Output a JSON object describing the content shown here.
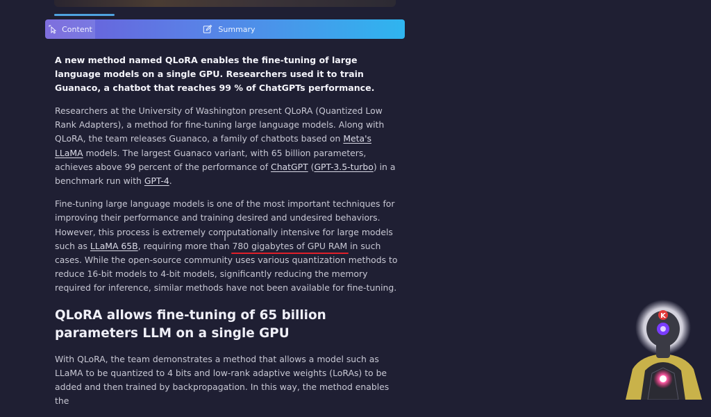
{
  "tabs": {
    "content_label": "Content",
    "summary_label": "Summary"
  },
  "article": {
    "lead": "A new method named QLoRA enables the fine-tuning of large language models on a single GPU. Researchers used it to train Guanaco, a chatbot that reaches 99 % of ChatGPTs performance.",
    "p1": {
      "t1": "Researchers at the University of Washington present QLoRA (Quantized Low Rank Adapters), a method for fine-tuning large language models. Along with QLoRA, the team releases Guanaco, a family of chatbots based on ",
      "link_llama": "Meta's LLaMA",
      "t2": " models. The largest Guanaco variant, with 65 billion parameters, achieves above 99 percent of the performance of ",
      "link_chatgpt": "ChatGPT",
      "t3": " (",
      "link_gpt35": "GPT-3.5-turbo",
      "t4": ") in a benchmark run with ",
      "link_gpt4": "GPT-4",
      "t5": "."
    },
    "p2": {
      "t1": "Fine-tuning large language models is one of the most important techniques for improving their performance and training desired and undesired behaviors. However, this process is extremely computationally intensive for large models such as ",
      "link_llama65b": "LLaMA 65B",
      "t2": ", requiring more than ",
      "highlight": "780 gigabytes of GPU RAM",
      "t3": " in such cases. While the open-source community uses various quantization methods to reduce 16-bit models to 4-bit models, significantly reducing the memory required for inference, similar methods have not been available for fine-tuning."
    },
    "heading": "QLoRA allows fine-tuning of 65 billion parameters LLM on a single GPU",
    "p3": "With QLoRA, the team demonstrates a method that allows a model such as LLaMA to be quantized to 4 bits and low-rank adaptive weights (LoRAs) to be added and then trained by backpropagation. In this way, the method enables the"
  },
  "avatar": {
    "badge_letter": "K"
  },
  "icons": {
    "content_tab": "pointer-sparkle-icon",
    "summary_tab": "edit-icon"
  }
}
